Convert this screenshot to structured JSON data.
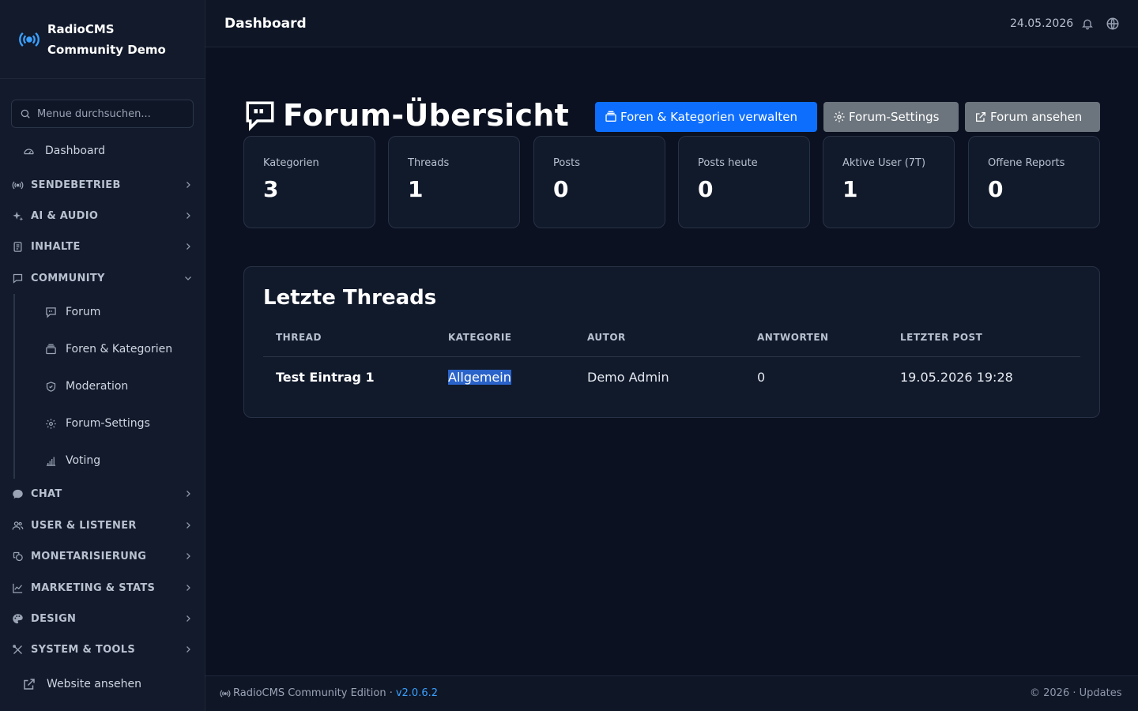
{
  "brand": {
    "line1": "RadioCMS",
    "line2": "Community Demo"
  },
  "search": {
    "placeholder": "Menue durchsuchen..."
  },
  "nav": {
    "dashboard": "Dashboard",
    "groups": [
      "SENDEBETRIEB",
      "AI & AUDIO",
      "INHALTE",
      "COMMUNITY",
      "CHAT",
      "USER & LISTENER",
      "MONETARISIERUNG",
      "MARKETING & STATS",
      "DESIGN",
      "SYSTEM & TOOLS"
    ],
    "community_items": [
      "Forum",
      "Foren & Kategorien",
      "Moderation",
      "Forum-Settings",
      "Voting"
    ],
    "website": "Website ansehen"
  },
  "header": {
    "title": "Dashboard",
    "date": "24.05.2026"
  },
  "page": {
    "title": "Forum-Übersicht",
    "buttons": {
      "manage": "Foren & Kategorien verwalten",
      "settings": "Forum-Settings",
      "view": "Forum ansehen"
    }
  },
  "stats": [
    {
      "label": "Kategorien",
      "value": "3"
    },
    {
      "label": "Threads",
      "value": "1"
    },
    {
      "label": "Posts",
      "value": "0"
    },
    {
      "label": "Posts heute",
      "value": "0"
    },
    {
      "label": "Aktive User (7T)",
      "value": "1"
    },
    {
      "label": "Offene Reports",
      "value": "0"
    }
  ],
  "threads": {
    "title": "Letzte Threads",
    "columns": [
      "THREAD",
      "KATEGORIE",
      "AUTOR",
      "ANTWORTEN",
      "LETZTER POST"
    ],
    "rows": [
      {
        "thread": "Test Eintrag 1",
        "category": "Allgemein",
        "author": "Demo Admin",
        "replies": "0",
        "last_post": "19.05.2026 19:28"
      }
    ]
  },
  "footer": {
    "text": "RadioCMS Community Edition ·",
    "version": "v2.0.6.2",
    "right": "© 2026   · Updates"
  },
  "colors": {
    "accent": "#0d6efd",
    "secondary": "#6c757d",
    "brand": "#3aa0ff",
    "bg": "#0b1120"
  }
}
